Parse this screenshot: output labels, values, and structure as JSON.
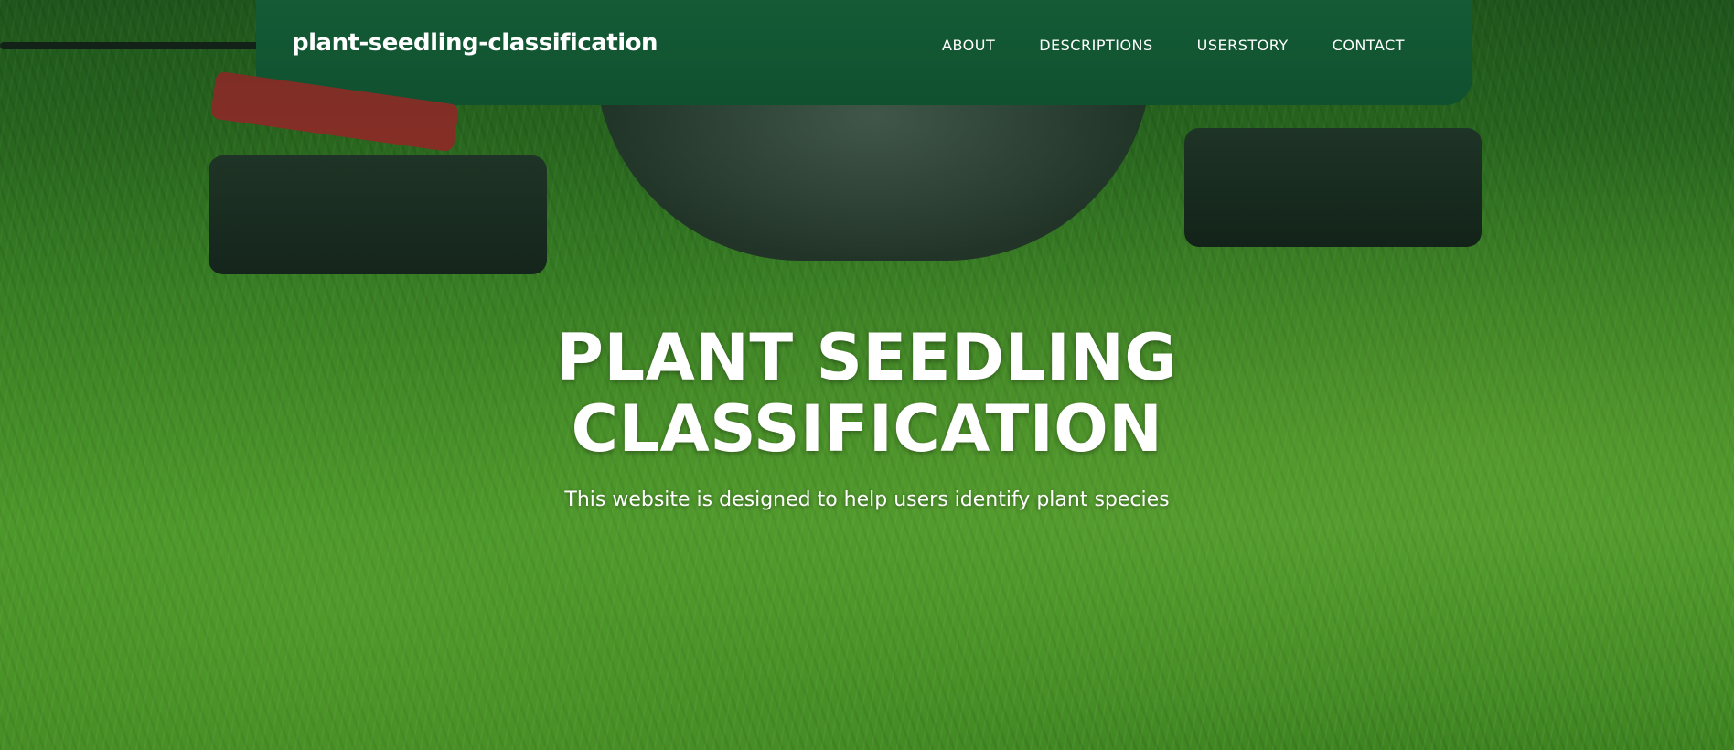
{
  "navbar": {
    "brand": "plant-seedling-classification",
    "links": [
      {
        "label": "ABOUT"
      },
      {
        "label": "DESCRIPTIONS"
      },
      {
        "label": "USERSTORY"
      },
      {
        "label": "CONTACT"
      }
    ]
  },
  "hero": {
    "title_line1": "PLANT SEEDLING",
    "title_line2": "CLASSIFICATION",
    "subtitle": "This website is designed to help users identify plant species",
    "background_image": "lawnmower-on-grass-photo"
  },
  "colors": {
    "grass": "#4ea22c",
    "mower_green": "#1f7a4a",
    "lever_red": "#b8322e",
    "text": "#ffffff"
  }
}
